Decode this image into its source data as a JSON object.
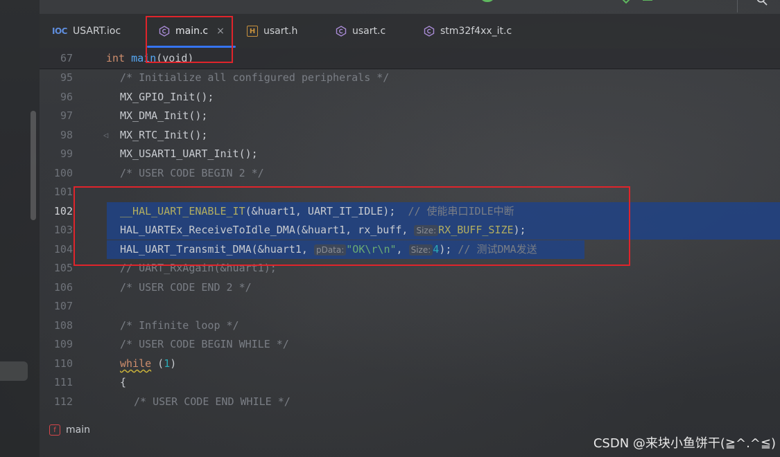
{
  "tabs": [
    {
      "label": "USART.ioc",
      "icon": "ioc-file-icon"
    },
    {
      "label": "main.c",
      "icon": "c-file-icon",
      "active": true
    },
    {
      "label": "usart.h",
      "icon": "h-file-icon"
    },
    {
      "label": "usart.c",
      "icon": "c-file-icon"
    },
    {
      "label": "stm32f4xx_it.c",
      "icon": "c-file-icon"
    }
  ],
  "icons": {
    "ioc": "IOC",
    "h": "H",
    "close": "×"
  },
  "sticky": {
    "line_number": "67",
    "kw": "int",
    "fn": "main",
    "rest": "(void)"
  },
  "lines": [
    {
      "n": "95",
      "a": "/* Initialize all configured peripherals */"
    },
    {
      "n": "96",
      "a": "MX_GPIO_Init();"
    },
    {
      "n": "97",
      "a": "MX_DMA_Init();"
    },
    {
      "n": "98",
      "a": "MX_RTC_Init();"
    },
    {
      "n": "99",
      "a": "MX_USART1_UART_Init();"
    },
    {
      "n": "100",
      "a": "/* USER CODE BEGIN 2 */"
    },
    {
      "n": "101"
    },
    {
      "n": "102",
      "a": "__HAL_UART_ENABLE_IT",
      "b": "(&huart1, UART_IT_IDLE);  ",
      "c": "// 使能串口IDLE中断"
    },
    {
      "n": "103",
      "a": "HAL_UARTEx_ReceiveToIdle_DMA(&huart1, rx_buff, ",
      "h1": "Size:",
      "b": "RX_BUFF_SIZE",
      "c": ");"
    },
    {
      "n": "104",
      "a": "HAL_UART_Transmit_DMA(&huart1, ",
      "h1": "pData:",
      "s": "\"OK\\r\\n\"",
      "c1": ", ",
      "h2": "Size:",
      "num": "4",
      "c2": "); ",
      "c": "// 测试DMA发送"
    },
    {
      "n": "105",
      "a": "// UART_RxAgain(&huart1);"
    },
    {
      "n": "106",
      "a": "/* USER CODE END 2 */"
    },
    {
      "n": "107"
    },
    {
      "n": "108",
      "a": "/* Infinite loop */"
    },
    {
      "n": "109",
      "a": "/* USER CODE BEGIN WHILE */"
    },
    {
      "n": "110",
      "a": "while",
      "b": " (",
      "num": "1",
      "c": ")"
    },
    {
      "n": "111",
      "a": "{"
    },
    {
      "n": "112",
      "a": "/* USER CODE END WHILE */"
    }
  ],
  "breadcrumb": {
    "icon_letter": "f",
    "label": "main"
  },
  "watermark": "CSDN @来块小鱼饼干(≧^.^≦)",
  "colors": {
    "accent": "#3574f0",
    "annotation_red": "#e0242b",
    "selection": "#214283"
  }
}
